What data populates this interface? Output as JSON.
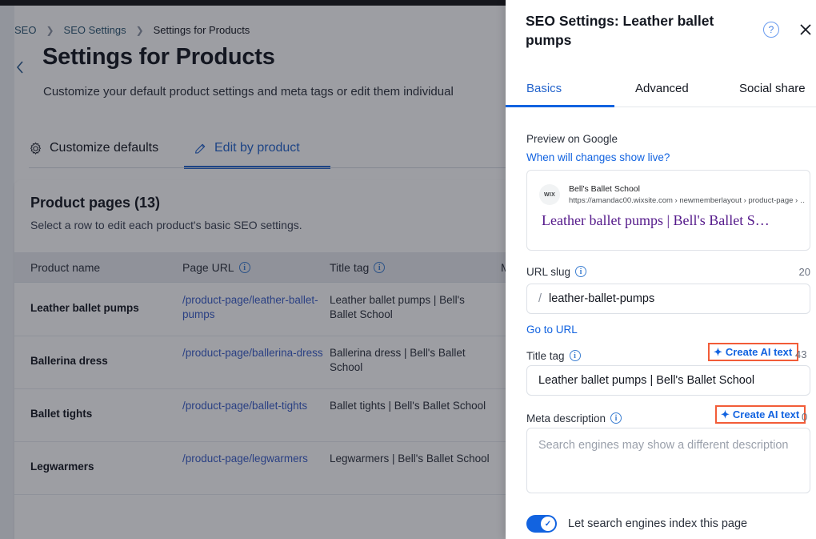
{
  "background": {
    "breadcrumb": [
      "SEO",
      "SEO Settings",
      "Settings for Products"
    ],
    "back_icon": "chevron-left-icon",
    "title": "Settings for Products",
    "subtitle": "Customize your default product settings and meta tags or edit them individual",
    "tabs": [
      {
        "label": "Customize defaults",
        "icon": "gear-icon",
        "active": false
      },
      {
        "label": "Edit by product",
        "icon": "pencil-icon",
        "active": true
      }
    ],
    "card": {
      "title": "Product pages (13)",
      "subtitle": "Select a row to edit each product's basic SEO settings.",
      "columns": [
        "Product name",
        "Page URL",
        "Title tag",
        "M"
      ],
      "rows": [
        {
          "name": "Leather ballet pumps",
          "url": "/product-page/leather-ballet-pumps",
          "title_tag": "Leather ballet pumps | Bell's Ballet School",
          "selected": true
        },
        {
          "name": "Ballerina dress",
          "url": "/product-page/ballerina-dress",
          "title_tag": "Ballerina dress | Bell's Ballet School",
          "selected": false
        },
        {
          "name": "Ballet tights",
          "url": "/product-page/ballet-tights",
          "title_tag": "Ballet tights | Bell's Ballet School",
          "selected": false
        },
        {
          "name": "Legwarmers",
          "url": "/product-page/legwarmers",
          "title_tag": "Legwarmers | Bell's Ballet School",
          "selected": false
        }
      ]
    }
  },
  "panel": {
    "title": "SEO Settings: Leather ballet pumps",
    "help_icon": "question-mark-icon",
    "close_icon": "close-icon",
    "tabs": [
      {
        "label": "Basics",
        "active": true
      },
      {
        "label": "Advanced",
        "active": false
      },
      {
        "label": "Social share",
        "active": false
      }
    ],
    "preview": {
      "label": "Preview on Google",
      "link": "When will changes show live?",
      "favicon_text": "WIX",
      "site_name": "Bell's Ballet School",
      "url": "https://amandac00.wixsite.com › newmemberlayout › product-page › …",
      "title": "Leather ballet pumps | Bell's Ballet S…"
    },
    "url_slug": {
      "label": "URL slug",
      "info_icon": "info-icon",
      "counter": "20",
      "prefix": "/",
      "value": "leather-ballet-pumps",
      "go_link": "Go to URL"
    },
    "title_tag": {
      "label": "Title tag",
      "info_icon": "info-icon",
      "ai_button": "Create AI text",
      "ai_icon": "sparkle-icon",
      "counter": "43",
      "value": "Leather ballet pumps | Bell's Ballet School"
    },
    "meta_description": {
      "label": "Meta description",
      "info_icon": "info-icon",
      "ai_button": "Create AI text",
      "ai_icon": "sparkle-icon",
      "counter": "0",
      "value": "",
      "placeholder": "Search engines may show a different description"
    },
    "index_toggle": {
      "label": "Let search engines index this page",
      "on": true,
      "check_icon": "check-icon"
    }
  },
  "colors": {
    "accent_blue": "#1263e0",
    "link_blue": "#2464cc",
    "highlight_orange": "#f25c38",
    "google_title_purple": "#551a8b",
    "text_dark": "#131720"
  }
}
